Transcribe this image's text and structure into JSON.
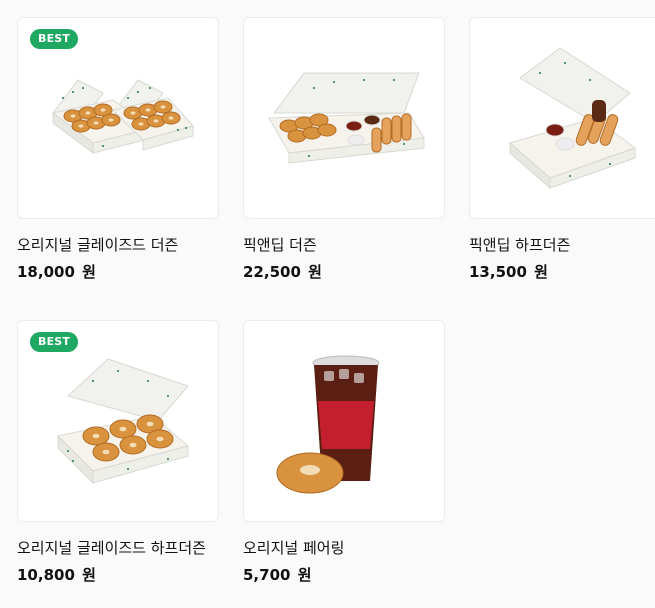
{
  "products": [
    {
      "name": "오리지널 글레이즈드 더즌",
      "price": "18,000",
      "currency": "원",
      "badge": "BEST",
      "image": "glazed-dozen-box-icon"
    },
    {
      "name": "픽앤딥 더즌",
      "price": "22,500",
      "currency": "원",
      "badge": null,
      "image": "pick-n-dip-dozen-box-icon"
    },
    {
      "name": "픽앤딥 하프더즌",
      "price": "13,500",
      "currency": "원",
      "badge": null,
      "image": "pick-n-dip-half-dozen-box-icon"
    },
    {
      "name": "오리지널 글레이즈드 하프더즌",
      "price": "10,800",
      "currency": "원",
      "badge": "BEST",
      "image": "glazed-half-dozen-box-icon"
    },
    {
      "name": "오리지널 페어링",
      "price": "5,700",
      "currency": "원",
      "badge": null,
      "image": "coffee-donut-pairing-icon"
    }
  ],
  "colors": {
    "badge": "#1fa862",
    "glaze": "#d9923e",
    "box": "#f4f4f1",
    "box_dots": "#1f7a4d",
    "coffee_cup": "#c41f2e"
  }
}
